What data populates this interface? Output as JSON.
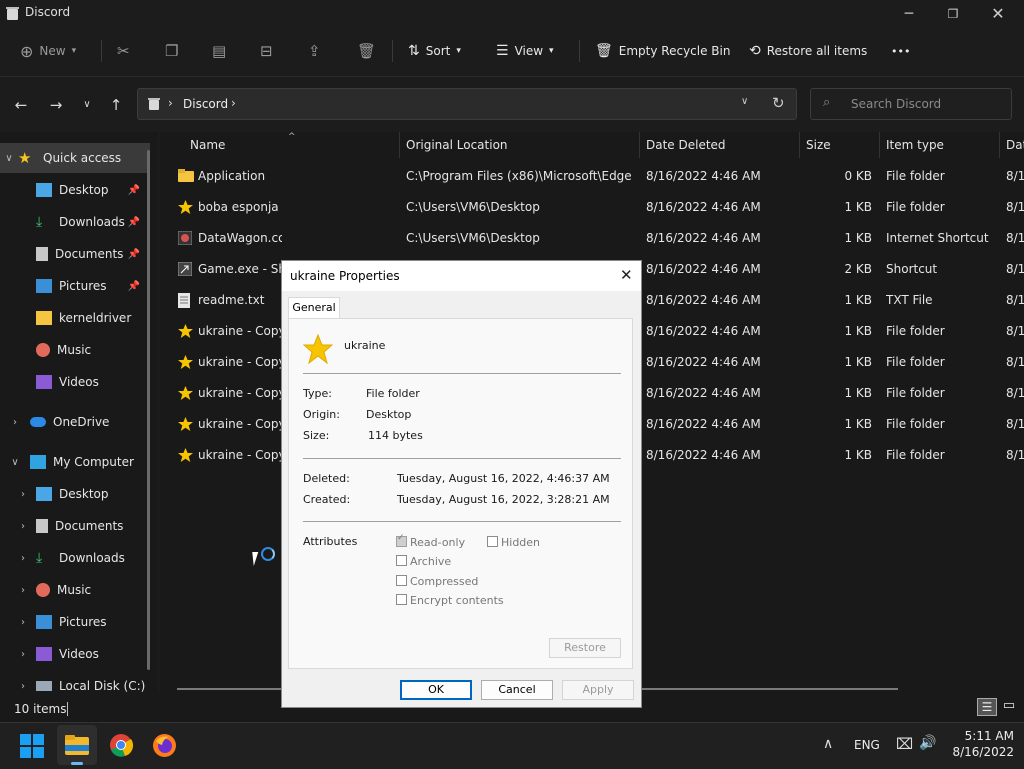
{
  "window": {
    "title": "Discord"
  },
  "toolbar": {
    "new_label": "New",
    "sort_label": "Sort",
    "view_label": "View",
    "empty_label": "Empty Recycle Bin",
    "restore_all_label": "Restore all items",
    "more_label": "•••"
  },
  "address": {
    "location": "Discord",
    "search_placeholder": "Search Discord"
  },
  "nav": {
    "quick_access": "Quick access",
    "items": [
      {
        "label": "Desktop"
      },
      {
        "label": "Downloads"
      },
      {
        "label": "Documents"
      },
      {
        "label": "Pictures"
      },
      {
        "label": "kerneldriver"
      },
      {
        "label": "Music"
      },
      {
        "label": "Videos"
      }
    ],
    "onedrive": "OneDrive",
    "my_computer": "My Computer",
    "pc_items": [
      {
        "label": "Desktop"
      },
      {
        "label": "Documents"
      },
      {
        "label": "Downloads"
      },
      {
        "label": "Music"
      },
      {
        "label": "Pictures"
      },
      {
        "label": "Videos"
      },
      {
        "label": "Local Disk (C:)"
      }
    ]
  },
  "table": {
    "headers": [
      "Name",
      "Original Location",
      "Date Deleted",
      "Size",
      "Item type",
      "Dat"
    ],
    "rows": [
      {
        "name": "Application",
        "loc": "C:\\Program Files (x86)\\Microsoft\\Edge",
        "date": "8/16/2022 4:46 AM",
        "size": "0 KB",
        "type": "File folder",
        "d2": "8/1"
      },
      {
        "name": "boba esponja",
        "loc": "C:\\Users\\VM6\\Desktop",
        "date": "8/16/2022 4:46 AM",
        "size": "1 KB",
        "type": "File folder",
        "d2": "8/1"
      },
      {
        "name": "DataWagon.com",
        "loc": "C:\\Users\\VM6\\Desktop",
        "date": "8/16/2022 4:46 AM",
        "size": "1 KB",
        "type": "Internet Shortcut",
        "d2": "8/1"
      },
      {
        "name": "Game.exe - Sho",
        "loc": "",
        "date": "8/16/2022 4:46 AM",
        "size": "2 KB",
        "type": "Shortcut",
        "d2": "8/1"
      },
      {
        "name": "readme.txt",
        "loc": "",
        "date": "8/16/2022 4:46 AM",
        "size": "1 KB",
        "type": "TXT File",
        "d2": "8/1"
      },
      {
        "name": "ukraine - Copy",
        "loc": "",
        "date": "8/16/2022 4:46 AM",
        "size": "1 KB",
        "type": "File folder",
        "d2": "8/1"
      },
      {
        "name": "ukraine - Copy",
        "loc": "",
        "date": "8/16/2022 4:46 AM",
        "size": "1 KB",
        "type": "File folder",
        "d2": "8/1"
      },
      {
        "name": "ukraine - Copy",
        "loc": "",
        "date": "8/16/2022 4:46 AM",
        "size": "1 KB",
        "type": "File folder",
        "d2": "8/1"
      },
      {
        "name": "ukraine - Copy",
        "loc": "",
        "date": "8/16/2022 4:46 AM",
        "size": "1 KB",
        "type": "File folder",
        "d2": "8/1"
      },
      {
        "name": "ukraine - Copy",
        "loc": "",
        "date": "8/16/2022 4:46 AM",
        "size": "1 KB",
        "type": "File folder",
        "d2": "8/1"
      }
    ]
  },
  "status": {
    "count": "10 items"
  },
  "dialog": {
    "title": "ukraine Properties",
    "tab": "General",
    "name": "ukraine",
    "type_label": "Type:",
    "type_value": "File folder",
    "origin_label": "Origin:",
    "origin_value": "Desktop",
    "size_label": "Size:",
    "size_value": "114 bytes",
    "deleted_label": "Deleted:",
    "deleted_value": "Tuesday, August 16, 2022, 4:46:37 AM",
    "created_label": "Created:",
    "created_value": "Tuesday, August 16, 2022, 3:28:21 AM",
    "attributes_label": "Attributes",
    "readonly": "Read-only",
    "hidden": "Hidden",
    "archive": "Archive",
    "compressed": "Compressed",
    "encrypt": "Encrypt contents",
    "restore": "Restore",
    "ok": "OK",
    "cancel": "Cancel",
    "apply": "Apply"
  },
  "taskbar": {
    "lang": "ENG",
    "time": "5:11 AM",
    "date": "8/16/2022"
  }
}
